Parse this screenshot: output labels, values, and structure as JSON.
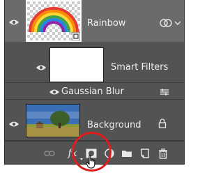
{
  "layers": [
    {
      "name": "Rainbow",
      "type": "smart-object"
    },
    {
      "name": "Smart Filters",
      "type": "smart-filter-mask"
    },
    {
      "name": "Gaussian Blur",
      "type": "filter"
    },
    {
      "name": "Background",
      "type": "background",
      "locked": true
    }
  ],
  "toolbar": {
    "fx_label": "fx",
    "icons": [
      "link-icon",
      "fx-icon",
      "layer-mask-icon",
      "adjustment-layer-icon",
      "group-folder-icon",
      "new-layer-icon",
      "trash-icon"
    ]
  },
  "colors": {
    "panel_bg": "#535353",
    "selected_row": "#6b6b6b",
    "highlight_circle": "#e01d1d",
    "text": "#f0f0f0"
  }
}
